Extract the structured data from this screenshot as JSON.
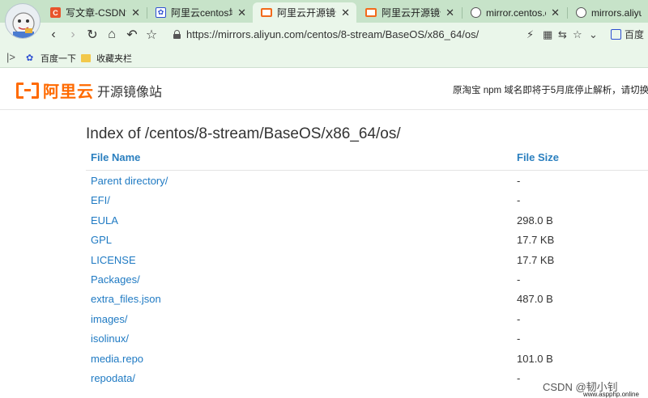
{
  "tabs": [
    {
      "label": "写文章-CSDN博客",
      "icon": "csdn-icon"
    },
    {
      "label": "阿里云centos地址",
      "icon": "baidu-paw-icon"
    },
    {
      "label": "阿里云开源镜像站",
      "icon": "aliyun-icon"
    },
    {
      "label": "阿里云开源镜像站",
      "icon": "aliyun-icon"
    },
    {
      "label": "mirror.centos.or",
      "icon": "globe-icon"
    },
    {
      "label": "mirrors.aliyuncs",
      "icon": "globe-icon"
    }
  ],
  "toolbar": {
    "url": "https://mirrors.aliyun.com/centos/8-stream/BaseOS/x86_64/os/",
    "search_engine_label": "百度"
  },
  "bookmarks": [
    {
      "label": "百度一下",
      "icon": "baidu-paw-icon"
    },
    {
      "label": "收藏夹栏",
      "icon": "folder-icon"
    }
  ],
  "site": {
    "logo_text": "阿里云",
    "title": "开源镜像站",
    "notice": "原淘宝 npm 域名即将于5月底停止解析，请切换"
  },
  "listing": {
    "heading": "Index of /centos/8-stream/BaseOS/x86_64/os/",
    "col_name": "File Name",
    "col_size": "File Size",
    "rows": [
      {
        "name": "Parent directory/",
        "size": "-"
      },
      {
        "name": "EFI/",
        "size": "-"
      },
      {
        "name": "EULA",
        "size": "298.0 B"
      },
      {
        "name": "GPL",
        "size": "17.7 KB"
      },
      {
        "name": "LICENSE",
        "size": "17.7 KB"
      },
      {
        "name": "Packages/",
        "size": "-"
      },
      {
        "name": "extra_files.json",
        "size": "487.0 B"
      },
      {
        "name": "images/",
        "size": "-"
      },
      {
        "name": "isolinux/",
        "size": "-"
      },
      {
        "name": "media.repo",
        "size": "101.0 B"
      },
      {
        "name": "repodata/",
        "size": "-"
      }
    ]
  },
  "watermark": "CSDN @韧小钊",
  "watermark_site": "www.aspphp.online",
  "colors": {
    "accent": "#ff6a00",
    "link": "#1f7ac3",
    "header_blue": "#2a7fbf",
    "tab_bg": "#c7e3c9"
  }
}
